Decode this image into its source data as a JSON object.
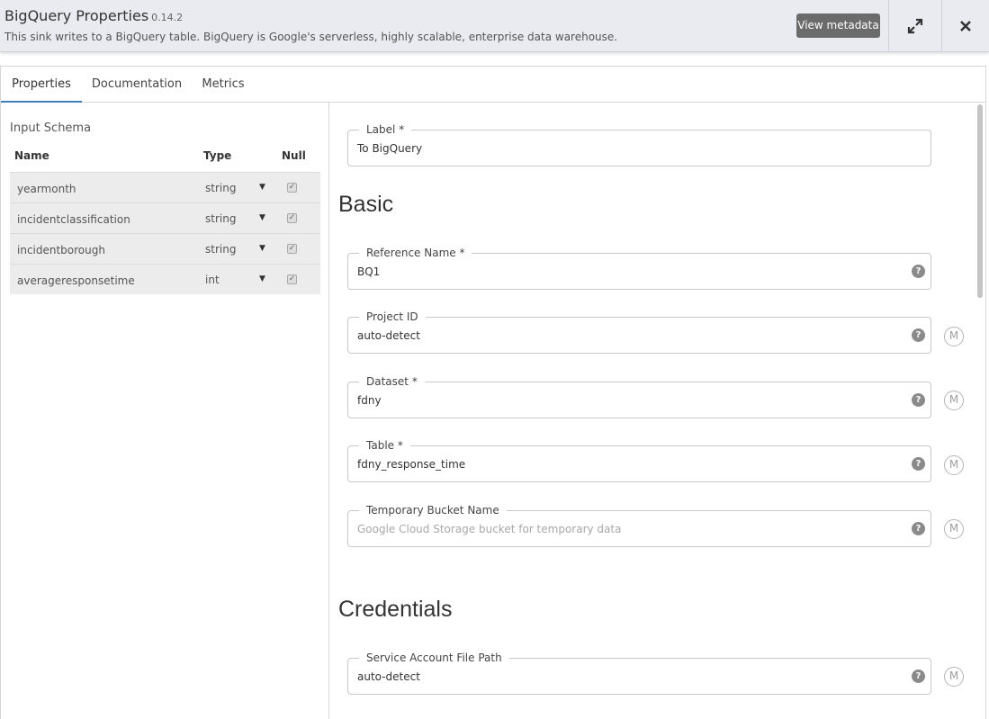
{
  "header": {
    "title": "BigQuery Properties",
    "version": "0.14.2",
    "description": "This sink writes to a BigQuery table. BigQuery is Google's serverless, highly scalable, enterprise data warehouse. Dat...",
    "view_metadata_label": "View metadata",
    "expand_icon": "expand-icon",
    "close_icon": "close-icon"
  },
  "tabs": [
    {
      "label": "Properties",
      "active": true
    },
    {
      "label": "Documentation",
      "active": false
    },
    {
      "label": "Metrics",
      "active": false
    }
  ],
  "schema": {
    "title": "Input Schema",
    "headers": {
      "name": "Name",
      "type": "Type",
      "null": "Null"
    },
    "rows": [
      {
        "name": "yearmonth",
        "type": "string",
        "nullable": true
      },
      {
        "name": "incidentclassification",
        "type": "string",
        "nullable": true
      },
      {
        "name": "incidentborough",
        "type": "string",
        "nullable": true
      },
      {
        "name": "averageresponsetime",
        "type": "int",
        "nullable": true
      }
    ]
  },
  "form": {
    "label_field": {
      "legend": "Label",
      "required_mark": "*",
      "value": "To BigQuery"
    },
    "basic_heading": "Basic",
    "reference_name": {
      "legend": "Reference Name",
      "required_mark": "*",
      "value": "BQ1"
    },
    "project_id": {
      "legend": "Project ID",
      "value": "auto-detect"
    },
    "dataset": {
      "legend": "Dataset",
      "required_mark": "*",
      "value": "fdny"
    },
    "table": {
      "legend": "Table",
      "required_mark": "*",
      "value": "fdny_response_time"
    },
    "temp_bucket": {
      "legend": "Temporary Bucket Name",
      "value": "",
      "placeholder": "Google Cloud Storage bucket for temporary data"
    },
    "credentials_heading": "Credentials",
    "service_account": {
      "legend": "Service Account File Path",
      "value": "auto-detect"
    },
    "help_glyph": "?",
    "macro_glyph": "M"
  },
  "colors": {
    "header_bg": "#eaebf1",
    "active_tab": "#3f7fbf",
    "metadata_button": "#6b6b6b"
  }
}
